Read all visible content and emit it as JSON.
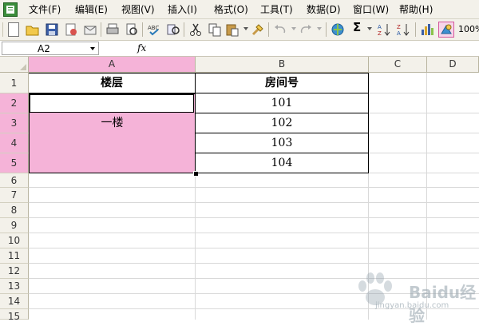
{
  "menu": {
    "items": [
      "文件(F)",
      "编辑(E)",
      "视图(V)",
      "插入(I)",
      "格式(O)",
      "工具(T)",
      "数据(D)",
      "窗口(W)",
      "帮助(H)"
    ]
  },
  "toolbar": {
    "icons": [
      "new-icon",
      "open-icon",
      "save-icon",
      "permission-icon",
      "email-icon",
      "print-icon",
      "print-preview-icon",
      "spelling-icon",
      "research-icon",
      "cut-icon",
      "copy-icon",
      "paste-icon",
      "format-painter-icon",
      "undo-icon",
      "redo-icon",
      "hyperlink-icon",
      "autosum-icon",
      "sort-ascending-icon",
      "sort-descending-icon",
      "chart-wizard-icon",
      "drawing-icon"
    ],
    "zoom": "100%",
    "autosum_symbol": "Σ"
  },
  "formula_bar": {
    "name_box": "A2",
    "fx_label": "fx",
    "formula": ""
  },
  "sheet": {
    "columns": [
      "A",
      "B",
      "C",
      "D"
    ],
    "rows": [
      "1",
      "2",
      "3",
      "4",
      "5",
      "6",
      "7",
      "8",
      "9",
      "10",
      "11",
      "12",
      "13",
      "14",
      "15"
    ],
    "header_row": {
      "a": "楼层",
      "b": "房间号"
    },
    "merged_a": "一楼",
    "room_numbers": [
      "101",
      "102",
      "103",
      "104"
    ]
  },
  "colors": {
    "selection_highlight": "#f5b3d8",
    "chrome": "#f3f1ea",
    "gridline": "#d9d9d9"
  },
  "watermark": {
    "text": "Baidu经验",
    "url": "jingyan.baidu.com"
  }
}
